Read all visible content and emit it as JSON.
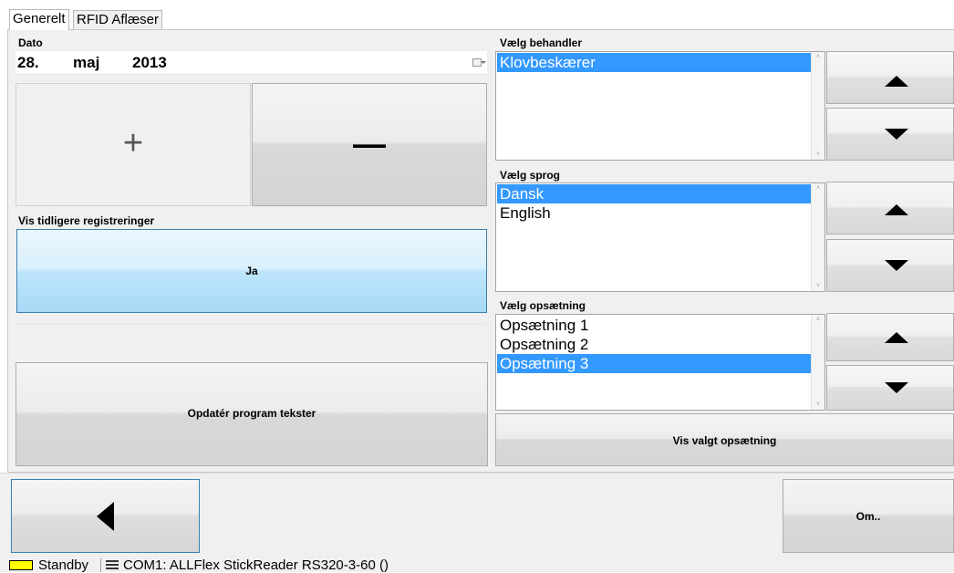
{
  "tabs": [
    {
      "label": "Generelt",
      "active": true
    },
    {
      "label": "RFID Aflæser",
      "active": false
    }
  ],
  "dato": {
    "label": "Dato",
    "day": "28.",
    "month": "maj",
    "year": "2013",
    "dropdown_icon": "calendar-dropdown-icon"
  },
  "stepper": {
    "plus_label": "+",
    "minus_label": "—"
  },
  "vis_tidligere": {
    "label": "Vis tidligere registreringer",
    "button_label": "Ja"
  },
  "update_button_label": "Opdatér program tekster",
  "behandler": {
    "label": "Vælg behandler",
    "items": [
      "Klovbeskærer"
    ],
    "selected_index": 0
  },
  "sprog": {
    "label": "Vælg sprog",
    "items": [
      "Dansk",
      "English"
    ],
    "selected_index": 0
  },
  "opsaetning": {
    "label": "Vælg opsætning",
    "items": [
      "Opsætning 1",
      "Opsætning 2",
      "Opsætning 3"
    ],
    "selected_index": 2
  },
  "vis_valgt_label": "Vis valgt opsætning",
  "footer": {
    "back_icon": "back-triangle-icon",
    "om_label": "Om.."
  },
  "status": {
    "state": "Standby",
    "state_color": "#ffff00",
    "port_icon": "serial-port-icon",
    "port_text": "COM1: ALLFlex StickReader RS320-3-60 ()"
  },
  "colors": {
    "selection": "#3399ff",
    "accent_button": "#a6d6ee"
  }
}
